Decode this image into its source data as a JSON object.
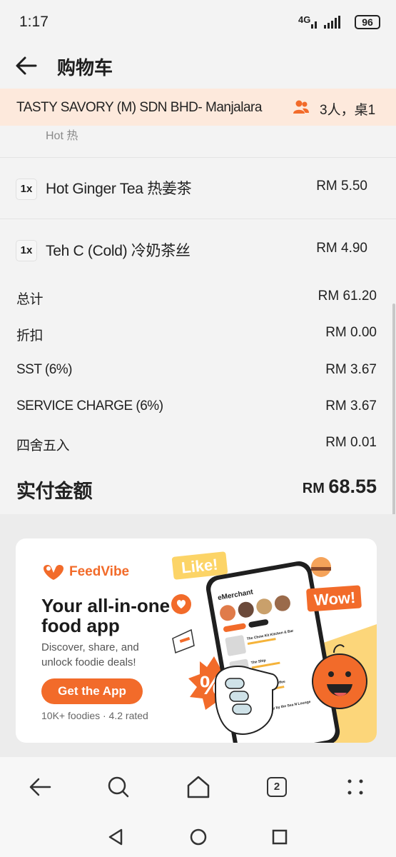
{
  "status_bar": {
    "time": "1:17",
    "network": "4G",
    "battery": "96"
  },
  "header": {
    "title": "购物车"
  },
  "store": {
    "name": "TASTY SAVORY (M) SDN BHD- Manjalara",
    "table_info": "3人，桌1"
  },
  "cart": {
    "prev_item_modifier": "Hot 热",
    "items": [
      {
        "qty": "1x",
        "name": "Hot Ginger Tea 热姜茶",
        "price": "RM 5.50"
      },
      {
        "qty": "1x",
        "name": "Teh C (Cold) 冷奶茶丝",
        "price": "RM 4.90"
      }
    ]
  },
  "summary": {
    "subtotal": {
      "label": "总计",
      "value": "RM 61.20"
    },
    "discount": {
      "label": "折扣",
      "value": "RM 0.00"
    },
    "sst": {
      "label": "SST (6%)",
      "value": "RM 3.67"
    },
    "service_charge": {
      "label": "SERVICE CHARGE (6%)",
      "value": "RM 3.67"
    },
    "rounding": {
      "label": "四舍五入",
      "value": "RM 0.01"
    },
    "total": {
      "label": "实付金额",
      "currency": "RM ",
      "value": "68.55"
    }
  },
  "ad": {
    "brand": "FeedVibe",
    "headline": "Your all-in-one food app",
    "description": "Discover, share, and unlock foodie deals!",
    "cta": "Get the App",
    "rating": "10K+ foodies · 4.2 rated",
    "sticker_like": "Like!",
    "sticker_wow": "Wow!",
    "sticker_percent": "%",
    "phone_header": "eMerchant",
    "phone_listing_1": "The Chow Kit Kitchen & Bar",
    "phone_listing_2": "The Ship",
    "phone_listing_3": "September Coffee",
    "phone_listing_4": "The Alley by the Sea N Lounge"
  },
  "browser_nav": {
    "tab_count": "2"
  },
  "colors": {
    "accent": "#f26b2a",
    "banner_bg": "#fde9dc"
  }
}
